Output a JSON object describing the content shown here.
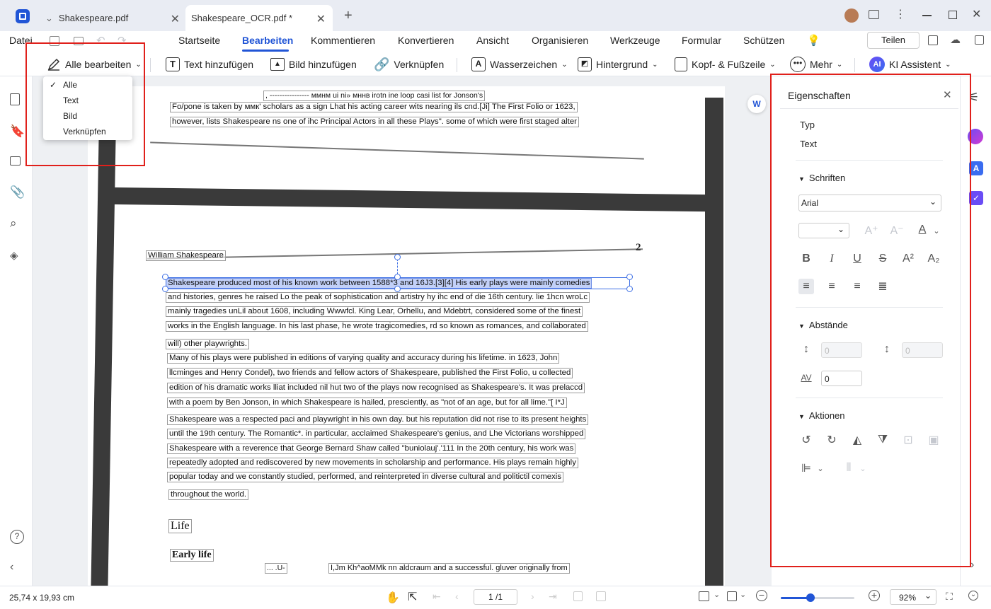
{
  "tabs": [
    {
      "label": "Shakespeare.pdf"
    },
    {
      "label": "Shakespeare_OCR.pdf *"
    }
  ],
  "menu": {
    "file": "Datei",
    "items": [
      "Startseite",
      "Bearbeiten",
      "Kommentieren",
      "Konvertieren",
      "Ansicht",
      "Organisieren",
      "Werkzeuge",
      "Formular",
      "Schützen"
    ],
    "share": "Teilen"
  },
  "toolbar": {
    "edit_all": "Alle bearbeiten",
    "add_text": "Text hinzufügen",
    "add_image": "Bild hinzufügen",
    "link": "Verknüpfen",
    "watermark": "Wasserzeichen",
    "background": "Hintergrund",
    "header_footer": "Kopf- & Fußzeile",
    "more": "Mehr",
    "ai": "KI Assistent",
    "ai_badge": "AI"
  },
  "dropdown": {
    "items": [
      "Alle",
      "Text",
      "Bild",
      "Verknüpfen"
    ],
    "selected": "Alle"
  },
  "properties": {
    "title": "Eigenschaften",
    "type_label": "Typ",
    "type_value": "Text",
    "fonts_section": "Schriften",
    "font_family": "Arial",
    "spacing_section": "Abstände",
    "line_spacing": "0",
    "para_spacing": "0",
    "char_spacing": "0",
    "char_spacing_label": "AV",
    "actions_section": "Aktionen"
  },
  "document": {
    "top_header": ", ---------------- ммнм ui ni» мннв irotn ine loop casi list for Jonson's",
    "top_lines": [
      "Fo/pone is taken by ммк' scholars as a sign Lhat his acting career wits nearing ils cnd.[Ji] The First Folio or 1623,",
      "however, lists Shakespeare ns one of ihc Principal Actors in all these Plays\". some of which were first staged alter"
    ],
    "running_head": "William Shakespeare",
    "page_number": "2",
    "selected_line": "Shakespeare produced most of his known work between 1588*3 and 16J3.[3][4] His early plays were mainly comedies",
    "para1": [
      "and histories, genres he raised Lo the peak of sophistication and artistry hy ihc end of die 16th century. lie 1hcn wroLc",
      "mainly tragedies unLil about 1608, including Wwwfcl. King Lear, Orhellu, and Mdebtrt, considered some of the finest",
      "works in the English language. In his last phase, he wrote tragicomedies, rd so known as romances, and collaborated",
      "will) other playwrights."
    ],
    "para2": [
      "Many of his plays were published in editions of varying quality and accuracy during his lifetime. in 1623, John",
      "llcminges and Henry Condel), two friends and fellow actors of Shakespeare, published the First Folio, u collected",
      "edition of his dramatic works lliat included nil hut two of the plays now recognised as Shakespeare's. It was prelaccd",
      "with a poem by Ben Jonson, in which Shakespeare is hailed, presciently, as \"not of an age, but for all lime.\"[ I*J"
    ],
    "para3": [
      "Shakespeare was a respected paci and playwright in his own day. but his reputation did not rise to its present heights",
      "until the 19th century. The Romantic*. in particular, acclaimed Shakespeare's genius, and Lhe Victorians worshipped",
      "Shakespeare with a reverence that George Bernard Shaw called \"buniolauj'.'111 In the 20th century, his work was",
      "repeatedly adopted and rediscovered by new movements in scholarship and performance. His plays remain highly",
      "popular today and we constantly studied, performed, and reinterpreted in diverse cultural and politictil comexis",
      "throughout the world."
    ],
    "heading_life": "Life",
    "heading_early": "Early life",
    "bottom_frag1": "... .U-",
    "bottom_frag2": "I,Jm Kh^aoMMk nn aldcraum and a successful. gluver originally from"
  },
  "status": {
    "dimensions": "25,74 x 19,93 cm",
    "page": "1 /1",
    "zoom": "92%"
  }
}
